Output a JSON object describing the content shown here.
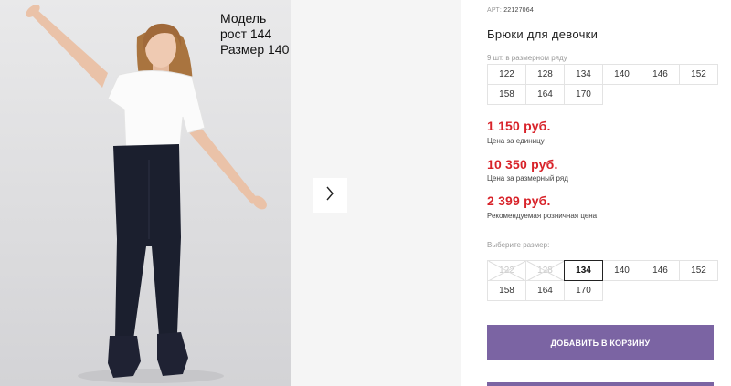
{
  "gallery": {
    "model_height_label": "Модель рост 144",
    "model_size_label": "Размер 140"
  },
  "product": {
    "article_prefix": "АРТ:",
    "article_number": "22127064",
    "title": "Брюки для девочки",
    "range_caption": "9 шт. в размерном ряду",
    "range_sizes": [
      "122",
      "128",
      "134",
      "140",
      "146",
      "152",
      "158",
      "164",
      "170"
    ]
  },
  "prices": {
    "unit_price": "1 150 руб.",
    "unit_caption": "Цена за единицу",
    "range_price": "10 350 руб.",
    "range_caption": "Цена за размерный ряд",
    "retail_price": "2 399 руб.",
    "retail_caption": "Рекомендуемая розничная цена"
  },
  "size_select": {
    "label": "Выберите размер:",
    "options": [
      {
        "value": "122",
        "state": "disabled"
      },
      {
        "value": "128",
        "state": "disabled"
      },
      {
        "value": "134",
        "state": "selected"
      },
      {
        "value": "140",
        "state": "available"
      },
      {
        "value": "146",
        "state": "available"
      },
      {
        "value": "152",
        "state": "available"
      },
      {
        "value": "158",
        "state": "available"
      },
      {
        "value": "164",
        "state": "available"
      },
      {
        "value": "170",
        "state": "available"
      }
    ]
  },
  "cart": {
    "add_label": "ДОБАВИТЬ В КОРЗИНУ"
  },
  "colors": {
    "price_red": "#d8232a",
    "button_purple": "#7b64a3",
    "gallery_bg": "#f5f5f5"
  },
  "icons": {
    "next": "chevron-right-icon"
  }
}
